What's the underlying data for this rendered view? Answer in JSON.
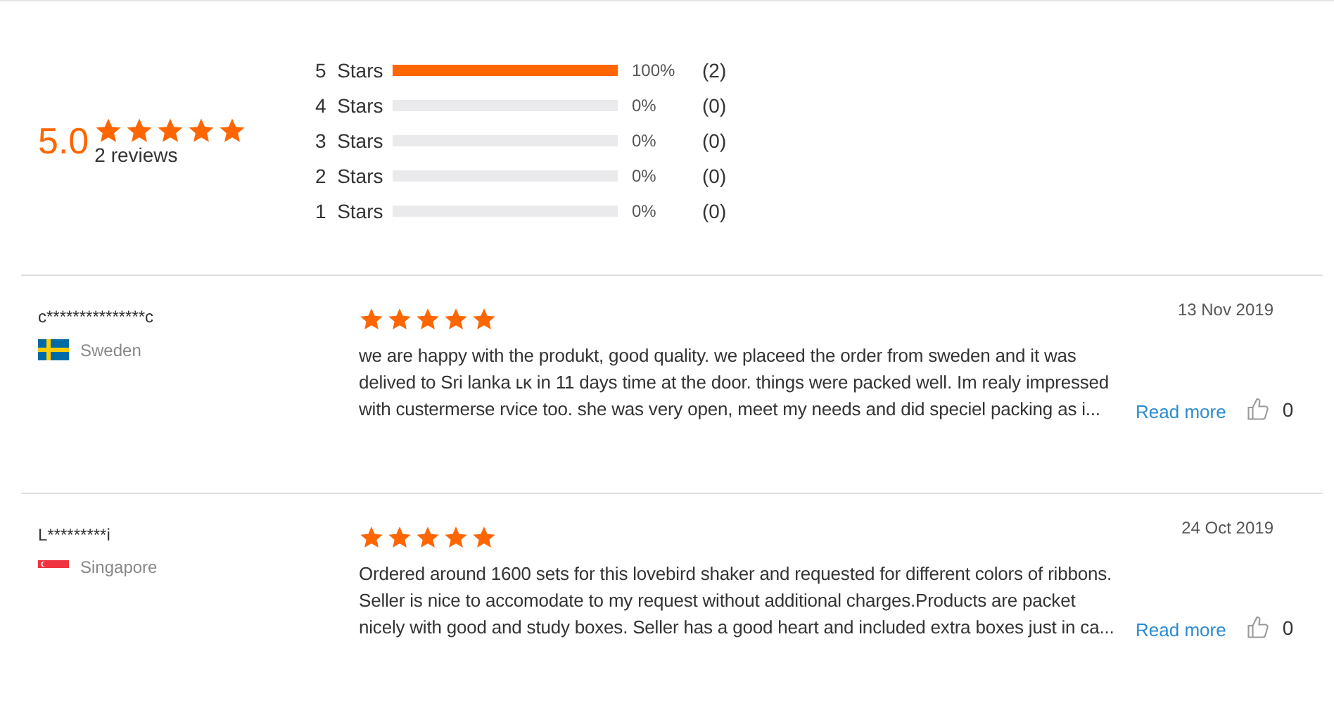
{
  "summary": {
    "score": "5.0",
    "stars": 5,
    "count": "2 reviews"
  },
  "breakdown": [
    {
      "label": "5",
      "unit": "Stars",
      "level": 1,
      "percent": "100%",
      "count": "(2)"
    },
    {
      "label": "4",
      "unit": "Stars",
      "level": 0,
      "percent": "0%",
      "count": "(0)"
    },
    {
      "label": "3",
      "unit": "Stars",
      "level": 0,
      "percent": "0%",
      "count": "(0)"
    },
    {
      "label": "2",
      "unit": "Stars",
      "level": 0,
      "percent": "0%",
      "count": "(0)"
    },
    {
      "label": "1",
      "unit": "Stars",
      "level": 0,
      "percent": "0%",
      "count": "(0)"
    }
  ],
  "reviews": [
    {
      "name": "c***************c",
      "country": "Sweden",
      "flag": {
        "kind": "sweden"
      },
      "stars": 5,
      "date": "13 Nov 2019",
      "text": "we are happy with the produkt, good quality. we placeed the order from sweden and it was delived to Sri lanka ʟᴋ in 11 days time at the door. things were packed well. Im realy impressed with custermerse rvice too. she was very open, meet my needs and did speciel packing as i...",
      "read_more": "Read more",
      "likes": "0"
    },
    {
      "name": "L*********i",
      "country": "Singapore",
      "flag": {
        "kind": "singapore"
      },
      "stars": 5,
      "date": "24 Oct 2019",
      "text": "Ordered around 1600 sets for this lovebird shaker and requested for different colors of ribbons. Seller is nice to accomodate to my request without additional charges.Products are packet nicely with good and study boxes. Seller has a good heart and included extra boxes just in ca...",
      "read_more": "Read more",
      "likes": "0"
    }
  ]
}
